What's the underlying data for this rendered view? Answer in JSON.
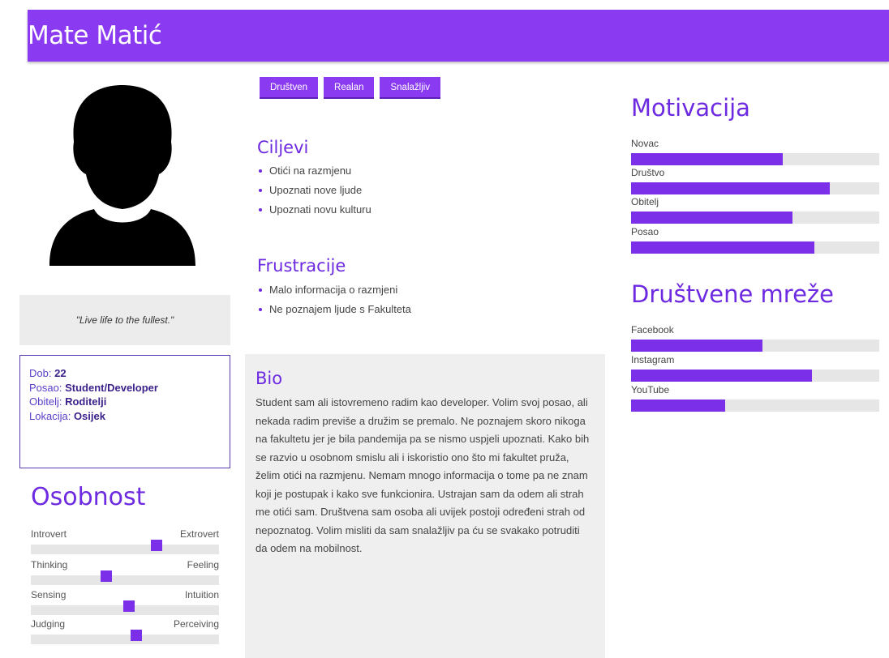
{
  "header": {
    "name": "Mate Matić"
  },
  "quote": "\"Live life to the fullest.\"",
  "info": {
    "age_label": "Dob:",
    "age": "22",
    "job_label": "Posao:",
    "job": "Student/Developer",
    "family_label": "Obitelj:",
    "family": "Roditelji",
    "location_label": "Lokacija:",
    "location": "Osijek"
  },
  "personality": {
    "title": "Osobnost",
    "rows": [
      {
        "left": "Introvert",
        "right": "Extrovert",
        "value": 0.67
      },
      {
        "left": "Thinking",
        "right": "Feeling",
        "value": 0.4
      },
      {
        "left": "Sensing",
        "right": "Intuition",
        "value": 0.52
      },
      {
        "left": "Judging",
        "right": "Perceiving",
        "value": 0.56
      }
    ]
  },
  "tags": [
    "Društven",
    "Realan",
    "Snalažljiv"
  ],
  "goals": {
    "title": "Ciljevi",
    "items": [
      "Otići na razmjenu",
      "Upoznati nove ljude",
      "Upoznati novu kulturu"
    ]
  },
  "frustrations": {
    "title": "Frustracije",
    "items": [
      "Malo informacija o razmjeni",
      "Ne poznajem ljude s Fakulteta"
    ]
  },
  "bio": {
    "title": "Bio",
    "text": "Student sam ali istovremeno radim kao developer. Volim svoj posao, ali nekada radim previše a družim se premalo. Ne poznajem skoro nikoga na fakultetu jer je bila pandemija pa se nismo uspjeli upoznati. Kako bih se razvio u osobnom smislu ali i iskoristio ono što mi fakultet pruža, želim otići na razmjenu. Nemam mnogo informacija o tome pa ne znam koji je postupak i kako sve funkcionira. Ustrajan sam da odem ali strah me otići sam. Društvena sam osoba ali uvijek postoji određeni strah od nepoznatog. Volim misliti da sam snalažljiv pa ću se svakako potruditi da odem na mobilnost."
  },
  "motivation": {
    "title": "Motivacija",
    "bars": [
      {
        "label": "Novac",
        "value": 0.61
      },
      {
        "label": "Društvo",
        "value": 0.8
      },
      {
        "label": "Obitelj",
        "value": 0.65
      },
      {
        "label": "Posao",
        "value": 0.74
      }
    ]
  },
  "social": {
    "title": "Društvene mreže",
    "bars": [
      {
        "label": "Facebook",
        "value": 0.53
      },
      {
        "label": "Instagram",
        "value": 0.73
      },
      {
        "label": "YouTube",
        "value": 0.38
      }
    ]
  },
  "colors": {
    "accent": "#8a3af0",
    "bar": "#7b2fe8",
    "track": "#e6e6e6"
  }
}
